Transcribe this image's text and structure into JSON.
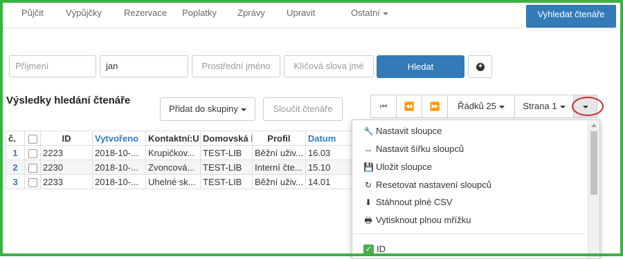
{
  "nav": {
    "items": [
      "Půjčit",
      "Výpůjčky",
      "Rezervace",
      "Poplatky",
      "Zprávy",
      "Upravit",
      "Ostatní"
    ],
    "search_button": "Vyhledat čtenáře"
  },
  "search": {
    "surname_placeholder": "Příjmení",
    "firstname_value": "jan",
    "middlename_placeholder": "Prostřední jméno",
    "keywords_placeholder": "Klíčová slova jmé",
    "submit_label": "Hledat"
  },
  "results": {
    "title": "Výsledky hledání čtenáře",
    "add_to_group": "Přidat do skupiny",
    "merge": "Sloučit čtenáře",
    "rows_label": "Řádků 25",
    "page_label": "Strana 1"
  },
  "table": {
    "headers": [
      "č.",
      "ID",
      "Vytvořeno",
      "Kontaktní:U",
      "Domovská k",
      "Profil",
      "Datum"
    ],
    "rows": [
      {
        "num": "1",
        "id": "2223",
        "created": "2018-10-...",
        "contact": "Krupičkov...",
        "home": "TEST-LIB",
        "profile": "Běžní uživ...",
        "date": "16.03"
      },
      {
        "num": "2",
        "id": "2230",
        "created": "2018-10-...",
        "contact": "Zvoncová...",
        "home": "TEST-LIB",
        "profile": "Interní čte...",
        "date": "15.10"
      },
      {
        "num": "3",
        "id": "2233",
        "created": "2018-10-...",
        "contact": "Uhelné sk...",
        "home": "TEST-LIB",
        "profile": "Běžní uživ...",
        "date": "14.01"
      }
    ]
  },
  "menu": {
    "items": [
      {
        "label": "Nastavit sloupce",
        "icon": "wrench-icon"
      },
      {
        "label": "Nastavit šířku sloupců",
        "icon": "resize-horizontal-icon"
      },
      {
        "label": "Uložit sloupce",
        "icon": "save-icon"
      },
      {
        "label": "Resetovat nastavení sloupců",
        "icon": "refresh-icon"
      },
      {
        "label": "Stáhnout plné CSV",
        "icon": "download-icon"
      },
      {
        "label": "Vytisknout plnou mřížku",
        "icon": "print-icon"
      }
    ],
    "checked_column": "ID"
  },
  "colors": {
    "accent": "#337ab7",
    "frame": "#3cb043",
    "highlight": "#c0282d",
    "check": "#4cae4c"
  }
}
